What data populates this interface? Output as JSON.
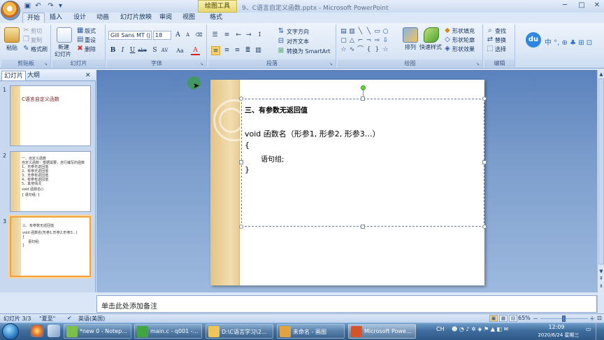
{
  "titlebar": {
    "contextual_tab": "绘图工具",
    "title": "9、C语言自定义函数.pptx - Microsoft PowerPoint",
    "qat": {
      "save": "▣",
      "undo": "↶",
      "redo": "↷",
      "more": "▾"
    },
    "controls": {
      "minimize": "─",
      "maximize": "□",
      "close": "✕"
    }
  },
  "tabs": [
    {
      "label": "开始"
    },
    {
      "label": "插入"
    },
    {
      "label": "设计"
    },
    {
      "label": "动画"
    },
    {
      "label": "幻灯片放映"
    },
    {
      "label": "审阅"
    },
    {
      "label": "视图"
    },
    {
      "label": "格式"
    }
  ],
  "ribbon": {
    "clipboard": {
      "group_label": "剪贴板",
      "paste": "粘贴",
      "cut": "剪切",
      "copy": "复制",
      "format_painter": "格式刷"
    },
    "slides": {
      "group_label": "幻灯片",
      "new_slide": "新建",
      "new_slide2": "幻灯片",
      "layout": "版式",
      "reset": "重设",
      "delete": "删除"
    },
    "font": {
      "group_label": "字体",
      "font_name": "Gill Sans MT (j",
      "font_size": "18"
    },
    "paragraph": {
      "group_label": "段落",
      "text_direction": "文字方向",
      "align_text": "对齐文本",
      "smartart": "转换为 SmartArt"
    },
    "drawing": {
      "group_label": "绘图",
      "arrange": "排列",
      "quick_styles": "快速样式",
      "shape_fill": "形状填充",
      "shape_outline": "形状轮廓",
      "shape_effects": "形状效果"
    },
    "editing": {
      "group_label": "编辑",
      "find": "查找",
      "replace": "替换",
      "select": "选择"
    },
    "baidu": {
      "logo": "du",
      "toolbar": "中 °, ⊕ ♣ ⊞ ⊡"
    }
  },
  "left_pane": {
    "tab_slides": "幻灯片",
    "tab_outline": "大纲",
    "close": "✕",
    "thumbs": [
      {
        "num": "1",
        "lines": [
          "C语言自定义函数"
        ]
      },
      {
        "num": "2",
        "lines": [
          "一、自定义函数",
          "自定义函数：根据需要，自行编写的函数",
          "1、无参无返回值",
          "2、有参无返回值",
          "3、无参有返回值",
          "4、有参有返回值",
          "5、其他情况",
          "void 函数名()",
          "{ 语句组; }"
        ]
      },
      {
        "num": "3",
        "lines": [
          "三、有参数无返回值",
          "void 函数名(形参1,形参2,形参3...)",
          "{",
          "语句组;",
          "}"
        ]
      }
    ]
  },
  "slide": {
    "heading": "三、有参数无返回值",
    "line1": "void    函数名（形参1, 形参2, 形参3…）",
    "line2": "{",
    "line3": "语句组;",
    "line4": "}"
  },
  "notes": {
    "placeholder": "单击此处添加备注"
  },
  "statusbar": {
    "slide_count": "幻灯片 3/3",
    "theme": "\"夏至\"",
    "language": "英语(美国)",
    "zoom": "65%",
    "zoom_fraction": 0.65,
    "zoom_minus": "－",
    "zoom_plus": "＋"
  },
  "taskbar": {
    "tasks": [
      {
        "label": "*new 0 - Notep...",
        "color": "#7cbf4a"
      },
      {
        "label": "main.c - q001 -...",
        "color": "#41a540"
      },
      {
        "label": "D:\\C语言学习\\2...",
        "color": "#f1c45a"
      },
      {
        "label": "未命名 - 画图",
        "color": "#e0a340"
      },
      {
        "label": "Microsoft Powe...",
        "color": "#d5542c"
      }
    ],
    "tray_text": "CH",
    "time": "12:09",
    "date": "2020/6/24 星期三"
  },
  "colors": {
    "ribbon_bg": "#dde8f6",
    "editor_bg": "#7b9dcc",
    "slide_deco": "#e4c384",
    "selection": "#f2a23c",
    "taskbar": "#3e6c9d"
  }
}
